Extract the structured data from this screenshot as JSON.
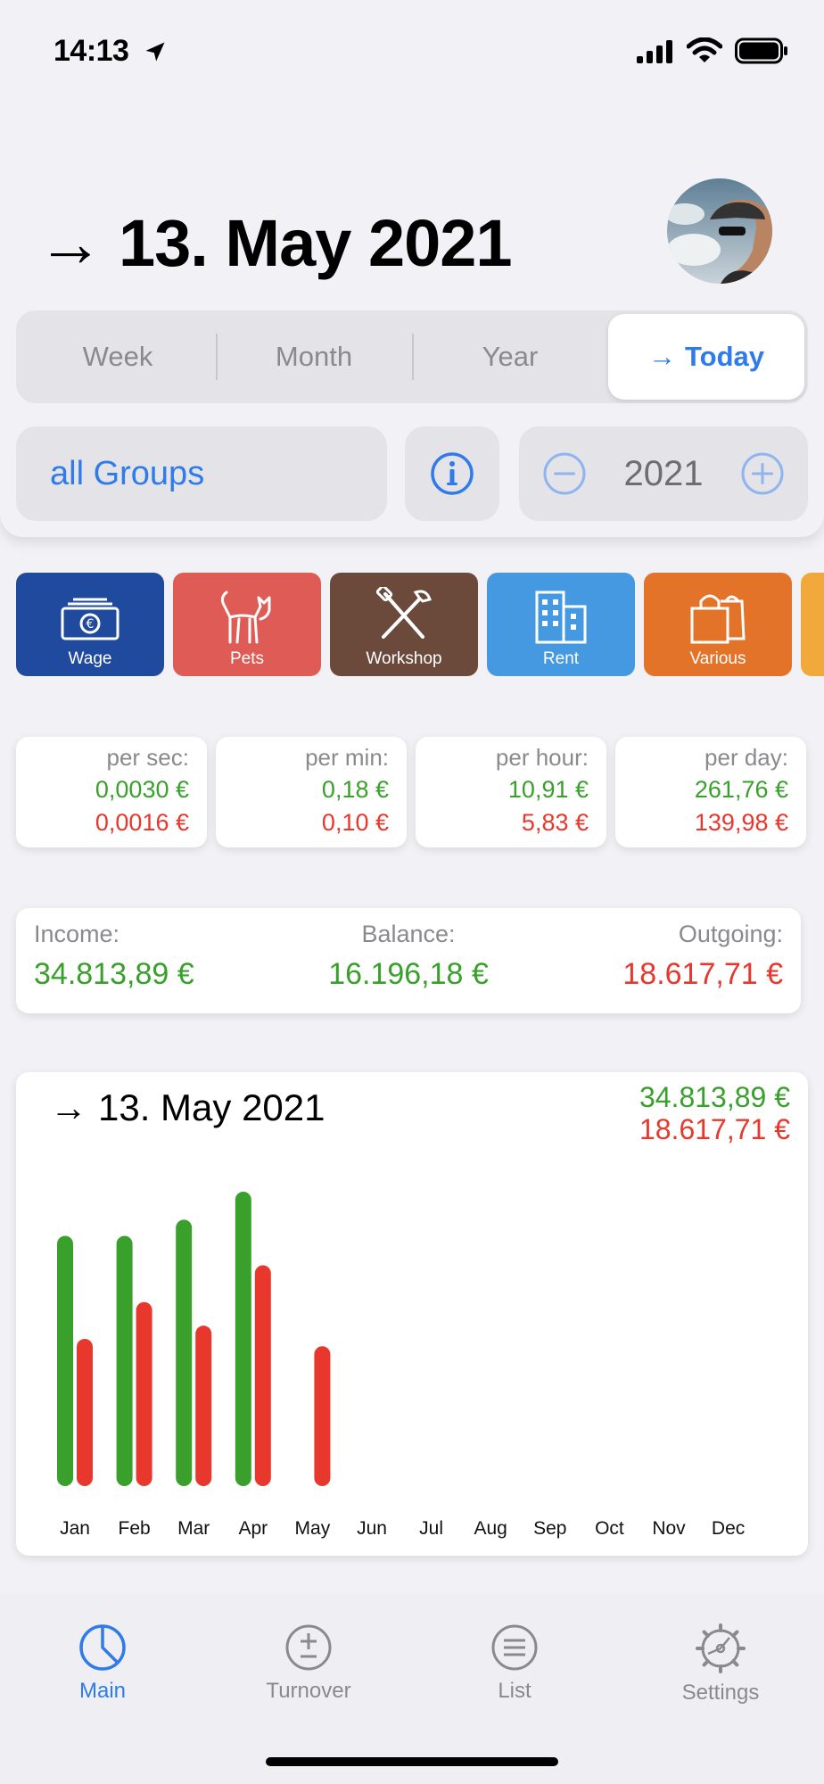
{
  "status_bar": {
    "time": "14:13"
  },
  "header": {
    "title": "13. May 2021",
    "title_arrow": "→",
    "segments": [
      {
        "label": "Week"
      },
      {
        "label": "Month"
      },
      {
        "label": "Year"
      },
      {
        "label": "Today",
        "arrow": "→",
        "selected": true
      }
    ],
    "groups_label": "all Groups",
    "year": "2021"
  },
  "categories": [
    {
      "label": "Wage",
      "color": "#1f4a9e",
      "icon": "money-icon"
    },
    {
      "label": "Pets",
      "color": "#df5b55",
      "icon": "cat-icon"
    },
    {
      "label": "Workshop",
      "color": "#6b4a3c",
      "icon": "tools-icon"
    },
    {
      "label": "Rent",
      "color": "#4599e1",
      "icon": "building-icon"
    },
    {
      "label": "Various",
      "color": "#e4732a",
      "icon": "shopping-bag-icon"
    }
  ],
  "rates": [
    {
      "label": "per sec:",
      "income": "0,0030 €",
      "outgoing": "0,0016 €"
    },
    {
      "label": "per min:",
      "income": "0,18 €",
      "outgoing": "0,10 €"
    },
    {
      "label": "per hour:",
      "income": "10,91 €",
      "outgoing": "5,83 €"
    },
    {
      "label": "per day:",
      "income": "261,76 €",
      "outgoing": "139,98 €"
    }
  ],
  "summary": {
    "income_label": "Income:",
    "income_value": "34.813,89 €",
    "balance_label": "Balance:",
    "balance_value": "16.196,18 €",
    "outgoing_label": "Outgoing:",
    "outgoing_value": "18.617,71 €"
  },
  "chart_header": {
    "title": "13. May 2021",
    "arrow": "→",
    "income_total": "34.813,89 €",
    "outgoing_total": "18.617,71 €"
  },
  "chart_data": {
    "type": "bar",
    "categories": [
      "Jan",
      "Feb",
      "Mar",
      "Apr",
      "May",
      "Jun",
      "Jul",
      "Aug",
      "Sep",
      "Oct",
      "Nov",
      "Dec"
    ],
    "series": [
      {
        "values": [
          0.85,
          0.85,
          0.905,
          1.0,
          null,
          null,
          null,
          null,
          null,
          null,
          null,
          null
        ],
        "color": "#3aa02c"
      },
      {
        "values": [
          0.5,
          0.625,
          0.545,
          0.75,
          0.475,
          null,
          null,
          null,
          null,
          null,
          null,
          null
        ],
        "color": "#e8382d"
      }
    ],
    "ylim": [
      0,
      1
    ],
    "grid": false,
    "legend": "none"
  },
  "tabs": [
    {
      "label": "Main",
      "active": true
    },
    {
      "label": "Turnover"
    },
    {
      "label": "List"
    },
    {
      "label": "Settings"
    }
  ],
  "colors": {
    "accent": "#2f7bea",
    "income": "#3aa02c",
    "outgoing": "#e8382d"
  }
}
